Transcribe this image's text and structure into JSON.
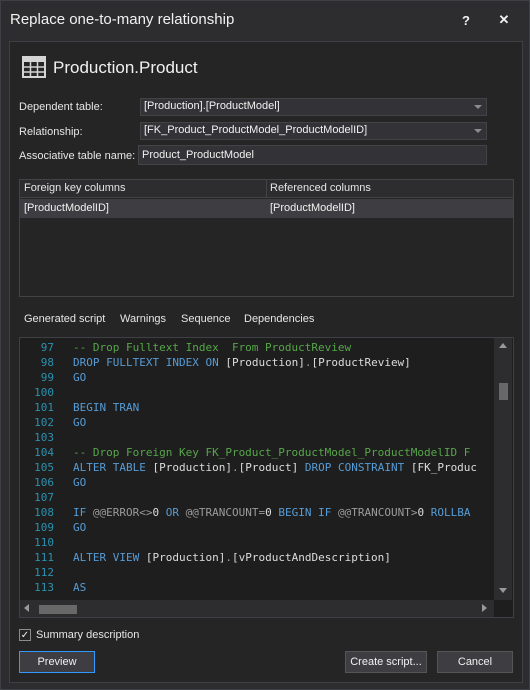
{
  "window": {
    "title": "Replace one-to-many relationship",
    "help_label": "?",
    "close_label": "✕"
  },
  "header": {
    "icon": "table-icon",
    "title": "Production.Product"
  },
  "form": {
    "dependent_table_label": "Dependent table:",
    "dependent_table_value": "[Production].[ProductModel]",
    "relationship_label": "Relationship:",
    "relationship_value": "[FK_Product_ProductModel_ProductModelID]",
    "associative_table_label": "Associative table name:",
    "associative_table_value": "Product_ProductModel"
  },
  "columns_grid": {
    "headers": [
      "Foreign key columns",
      "Referenced columns"
    ],
    "rows": [
      [
        "[ProductModelID]",
        "[ProductModelID]"
      ]
    ]
  },
  "tabs": [
    {
      "label": "Generated script",
      "active": true
    },
    {
      "label": "Warnings",
      "active": false
    },
    {
      "label": "Sequence",
      "active": false
    },
    {
      "label": "Dependencies",
      "active": false
    }
  ],
  "script": {
    "lines": [
      {
        "num": "97",
        "text": "-- Drop Fulltext Index  From ProductReview"
      },
      {
        "num": "98",
        "text": "DROP FULLTEXT INDEX ON [Production].[ProductReview]"
      },
      {
        "num": "99",
        "text": "GO"
      },
      {
        "num": "100",
        "text": ""
      },
      {
        "num": "101",
        "text": "BEGIN TRAN"
      },
      {
        "num": "102",
        "text": "GO"
      },
      {
        "num": "103",
        "text": ""
      },
      {
        "num": "104",
        "text": "-- Drop Foreign Key FK_Product_ProductModel_ProductModelID F"
      },
      {
        "num": "105",
        "text": "ALTER TABLE [Production].[Product] DROP CONSTRAINT [FK_Produc"
      },
      {
        "num": "106",
        "text": "GO"
      },
      {
        "num": "107",
        "text": ""
      },
      {
        "num": "108",
        "text": "IF @@ERROR<>0 OR @@TRANCOUNT=0 BEGIN IF @@TRANCOUNT>0 ROLLBA"
      },
      {
        "num": "109",
        "text": "GO"
      },
      {
        "num": "110",
        "text": ""
      },
      {
        "num": "111",
        "text": "ALTER VIEW [Production].[vProductAndDescription]"
      },
      {
        "num": "112",
        "text": ""
      },
      {
        "num": "113",
        "text": "AS"
      }
    ]
  },
  "summary": {
    "checked": true,
    "label": "Summary description"
  },
  "buttons": {
    "preview": "Preview",
    "create_script": "Create script...",
    "cancel": "Cancel"
  },
  "colors": {
    "background": "#2d2d30",
    "panel": "#252526",
    "editor": "#1e1e1e",
    "keyword": "#569cd6",
    "comment": "#57a64a",
    "line_number": "#2b91af",
    "accent": "#3399ff"
  }
}
